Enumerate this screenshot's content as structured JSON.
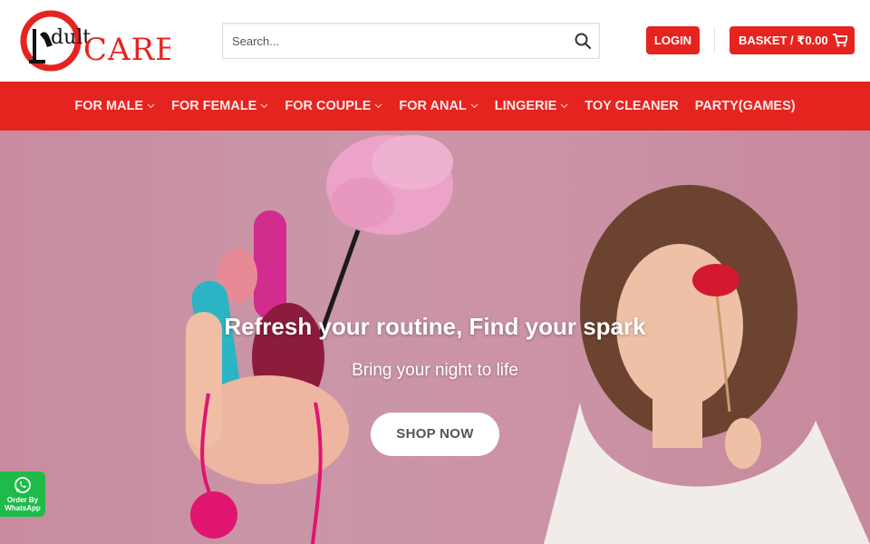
{
  "brand": {
    "logo_text_a": "dult",
    "logo_text_b": "CARE",
    "accent_color": "#e52420"
  },
  "search": {
    "placeholder": "Search...",
    "icon": "search-icon"
  },
  "header": {
    "login_label": "LOGIN",
    "basket_label": "BASKET / ₹0.00",
    "cart_icon": "cart-icon"
  },
  "nav": {
    "items": [
      {
        "label": "FOR MALE",
        "dropdown": true
      },
      {
        "label": "FOR FEMALE",
        "dropdown": true
      },
      {
        "label": "FOR COUPLE",
        "dropdown": true
      },
      {
        "label": "FOR ANAL",
        "dropdown": true
      },
      {
        "label": "LINGERIE",
        "dropdown": true
      },
      {
        "label": "TOY CLEANER",
        "dropdown": false
      },
      {
        "label": "PARTY(GAMES)",
        "dropdown": false
      }
    ]
  },
  "hero": {
    "title": "Refresh your routine, Find your spark",
    "subtitle": "Bring your night to life",
    "cta_label": "SHOP NOW"
  },
  "whatsapp": {
    "line1": "Order By",
    "line2": "WhatsApp",
    "icon": "whatsapp-icon",
    "color": "#1fbb4a"
  }
}
